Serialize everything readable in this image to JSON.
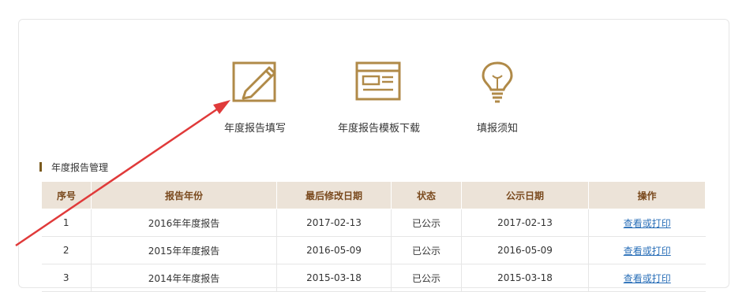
{
  "tools": [
    {
      "label": "年度报告填写",
      "icon": "edit-icon"
    },
    {
      "label": "年度报告模板下载",
      "icon": "template-icon"
    },
    {
      "label": "填报须知",
      "icon": "lightbulb-icon"
    }
  ],
  "section": {
    "title": "年度报告管理"
  },
  "table": {
    "headers": [
      "序号",
      "报告年份",
      "最后修改日期",
      "状态",
      "公示日期",
      "操作"
    ],
    "rows": [
      {
        "no": "1",
        "year": "2016年年度报告",
        "modified": "2017-02-13",
        "status": "已公示",
        "pub": "2017-02-13",
        "action": "查看或打印"
      },
      {
        "no": "2",
        "year": "2015年年度报告",
        "modified": "2016-05-09",
        "status": "已公示",
        "pub": "2016-05-09",
        "action": "查看或打印"
      },
      {
        "no": "3",
        "year": "2014年年度报告",
        "modified": "2015-03-18",
        "status": "已公示",
        "pub": "2015-03-18",
        "action": "查看或打印"
      }
    ]
  },
  "colors": {
    "icon": "#b08a48",
    "header_bg": "#ece3d8",
    "arrow": "#e03a3a",
    "link": "#2a6fb8"
  }
}
